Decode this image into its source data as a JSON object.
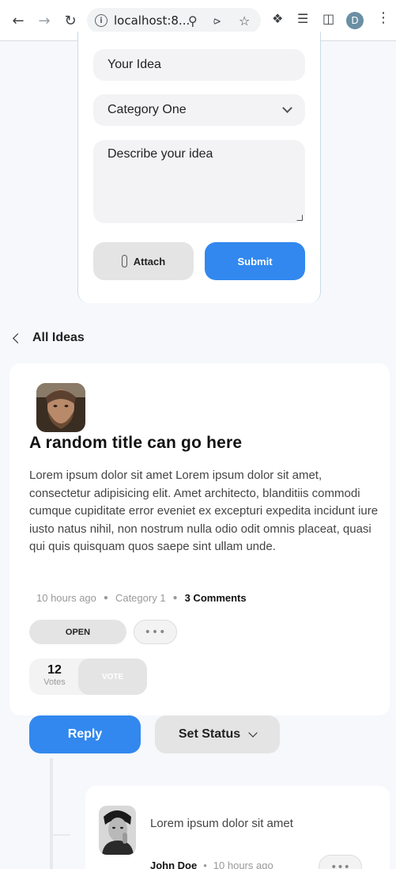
{
  "browser": {
    "url": "localhost:8...",
    "avatar_letter": "D"
  },
  "form": {
    "title_placeholder": "Your Idea",
    "category_selected": "Category One",
    "description_placeholder": "Describe your idea",
    "attach_label": "Attach",
    "submit_label": "Submit"
  },
  "nav": {
    "back_label": "All Ideas"
  },
  "idea": {
    "title": "A random title can go here",
    "body": "Lorem ipsum dolor sit amet Lorem ipsum dolor sit amet, consectetur adipisicing elit. Amet architecto, blanditiis commodi cumque cupiditate error eveniet ex excepturi expedita incidunt iure iusto natus nihil, non nostrum nulla odio odit omnis placeat, quasi qui quis quisquam quos saepe sint ullam unde.",
    "time_ago": "10 hours ago",
    "category": "Category 1",
    "comments": "3 Comments",
    "status": "OPEN",
    "more": "•••",
    "votes_count": "12",
    "votes_label": "Votes",
    "vote_button": "VOTE"
  },
  "actions": {
    "reply_label": "Reply",
    "set_status_label": "Set Status"
  },
  "comment": {
    "text": "Lorem ipsum dolor sit amet",
    "author": "John Doe",
    "time_ago": "10 hours ago",
    "more": "•••"
  },
  "colors": {
    "primary": "#3288ee",
    "muted_button": "#e4e4e4",
    "page_bg": "#f7f8fc"
  }
}
